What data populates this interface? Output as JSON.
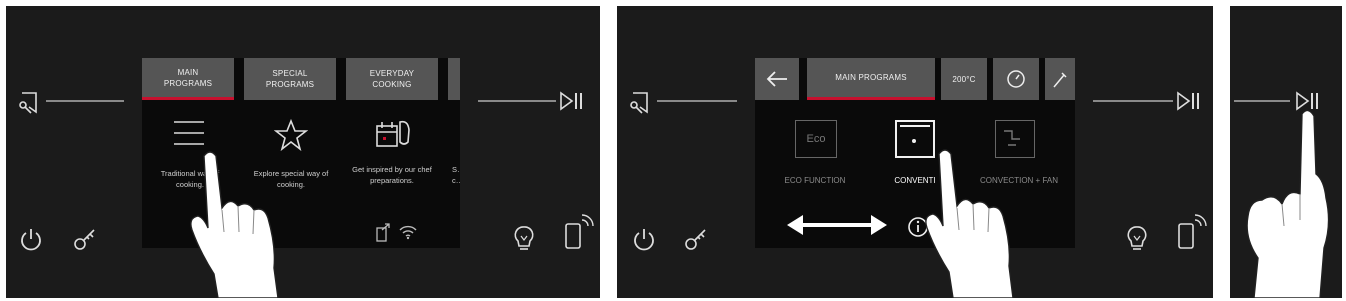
{
  "panel1": {
    "tabs": [
      {
        "line1": "MAIN",
        "line2": "PROGRAMS",
        "active": true
      },
      {
        "line1": "SPECIAL",
        "line2": "PROGRAMS",
        "active": false
      },
      {
        "line1": "EVERYDAY",
        "line2": "COOKING",
        "active": false
      }
    ],
    "items": [
      {
        "icon": "list-icon",
        "desc": "Traditional way of cooking."
      },
      {
        "icon": "star-icon",
        "desc": "Explore special way of cooking."
      },
      {
        "icon": "cookbook-icon",
        "desc": "Get inspired by our chef preparations."
      },
      {
        "desc_partial": "S… c…"
      }
    ],
    "status_icons": [
      "phone-arrow-icon",
      "wifi-icon"
    ]
  },
  "panel2": {
    "back_icon": "arrow-left-icon",
    "active_tab": "MAIN PROGRAMS",
    "temperature": "200°C",
    "programs": [
      {
        "icon_text": "Eco",
        "label": "ECO FUNCTION",
        "active": false
      },
      {
        "icon_text": "",
        "label": "CONVENTI",
        "active": true
      },
      {
        "icon_text": "",
        "label": "CONVECTION + FAN",
        "active": false
      }
    ],
    "info_icon": "info-icon"
  },
  "side_icons": [
    "recipe-book-icon",
    "power-icon",
    "key-icon",
    "bulb-icon",
    "remote-phone-icon",
    "play-pause-icon"
  ],
  "colors": {
    "panel_bg": "#1b1b1b",
    "screen_bg": "#0a0a0a",
    "tab_bg": "#555555",
    "accent": "#c8102e"
  }
}
